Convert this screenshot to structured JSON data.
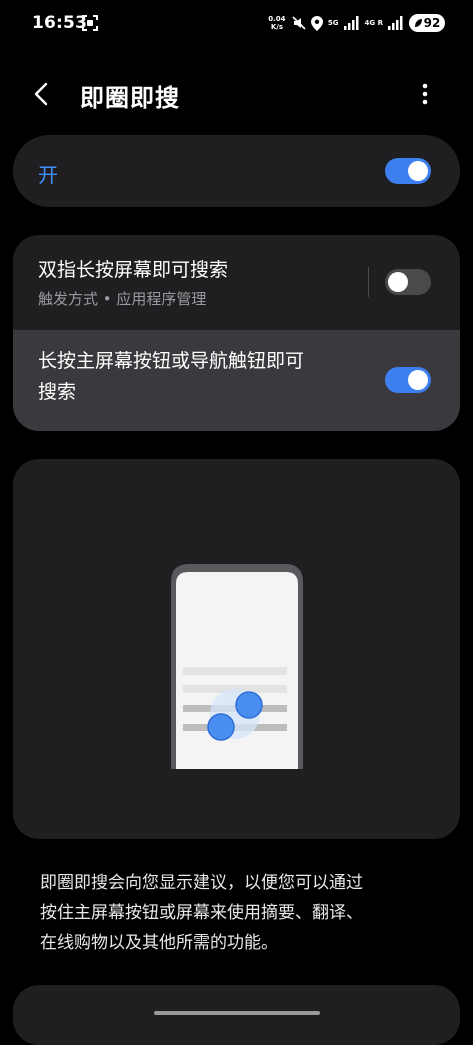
{
  "status_bar": {
    "time": "16:53",
    "net_speed_value": "0.04",
    "net_speed_unit": "K/s",
    "sig1_label": "5G",
    "sig2_label": "4G",
    "sig2_sub": "R",
    "battery": "92",
    "icons": [
      "screenshot-icon",
      "mute-icon",
      "location-icon",
      "signal-icon",
      "signal-icon",
      "battery-saver-icon"
    ]
  },
  "header": {
    "title": "即圈即搜",
    "back_icon": "chevron-left-icon",
    "more_icon": "more-vertical-icon"
  },
  "master_toggle": {
    "label": "开",
    "state": "on"
  },
  "options": [
    {
      "title": "双指长按屏幕即可搜索",
      "subtitle": "触发方式 • 应用程序管理",
      "state": "off"
    },
    {
      "title_line1": "长按主屏幕按钮或导航触钮即可",
      "title_line2": "搜索",
      "state": "on"
    }
  ],
  "description": {
    "line1": "即圈即搜会向您显示建议，以便您可以通过",
    "line2": "按住主屏幕按钮或屏幕来使用摘要、翻译、",
    "line3": "在线购物以及其他所需的功能。"
  },
  "colors": {
    "accent": "#3e91ff",
    "toggle_on": "#3e7ff0",
    "card_bg": "#1f1f21",
    "highlight_row": "#3a3a3e"
  }
}
